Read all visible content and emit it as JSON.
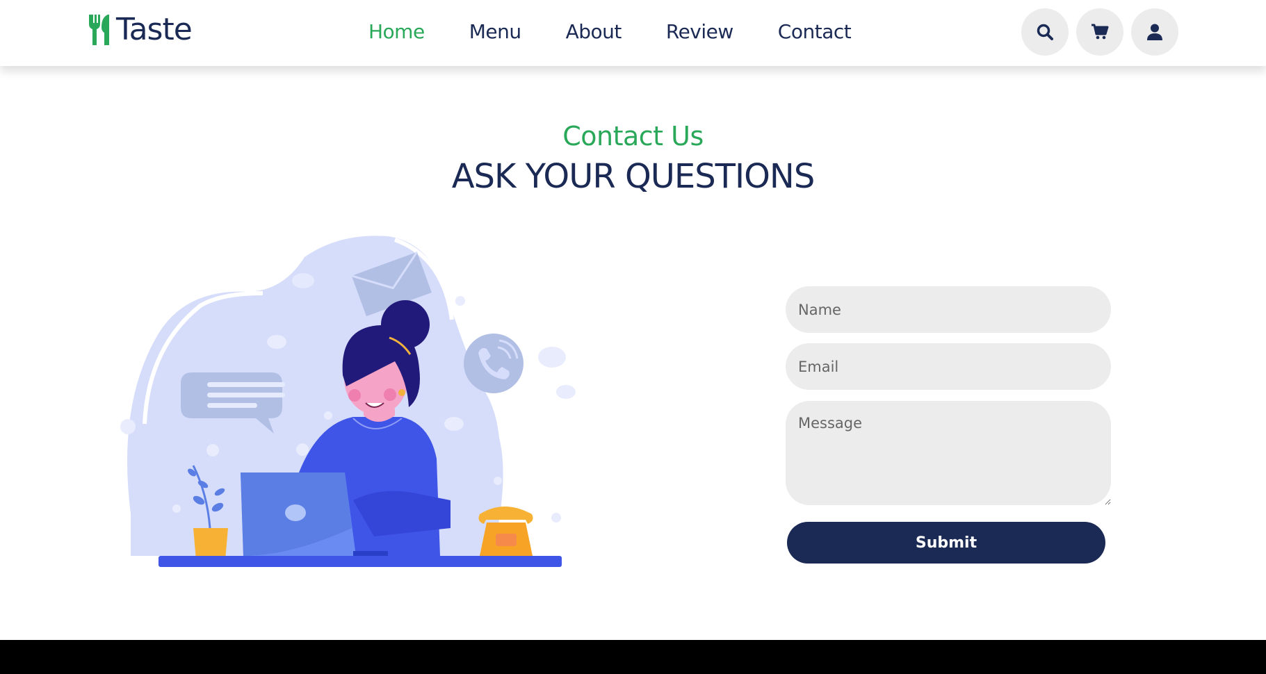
{
  "header": {
    "logo_text": "Taste",
    "nav": [
      {
        "label": "Home",
        "active": true
      },
      {
        "label": "Menu",
        "active": false
      },
      {
        "label": "About",
        "active": false
      },
      {
        "label": "Review",
        "active": false
      },
      {
        "label": "Contact",
        "active": false
      }
    ],
    "icons": [
      "search-icon",
      "cart-icon",
      "user-icon"
    ]
  },
  "contact": {
    "subtitle": "Contact Us",
    "title": "ASK YOUR QUESTIONS",
    "form": {
      "name_placeholder": "Name",
      "email_placeholder": "Email",
      "message_placeholder": "Message",
      "submit_label": "Submit"
    }
  },
  "colors": {
    "accent": "#2aa85a",
    "primary": "#1b2a55",
    "field_bg": "#ececec",
    "footer": "#000000"
  }
}
